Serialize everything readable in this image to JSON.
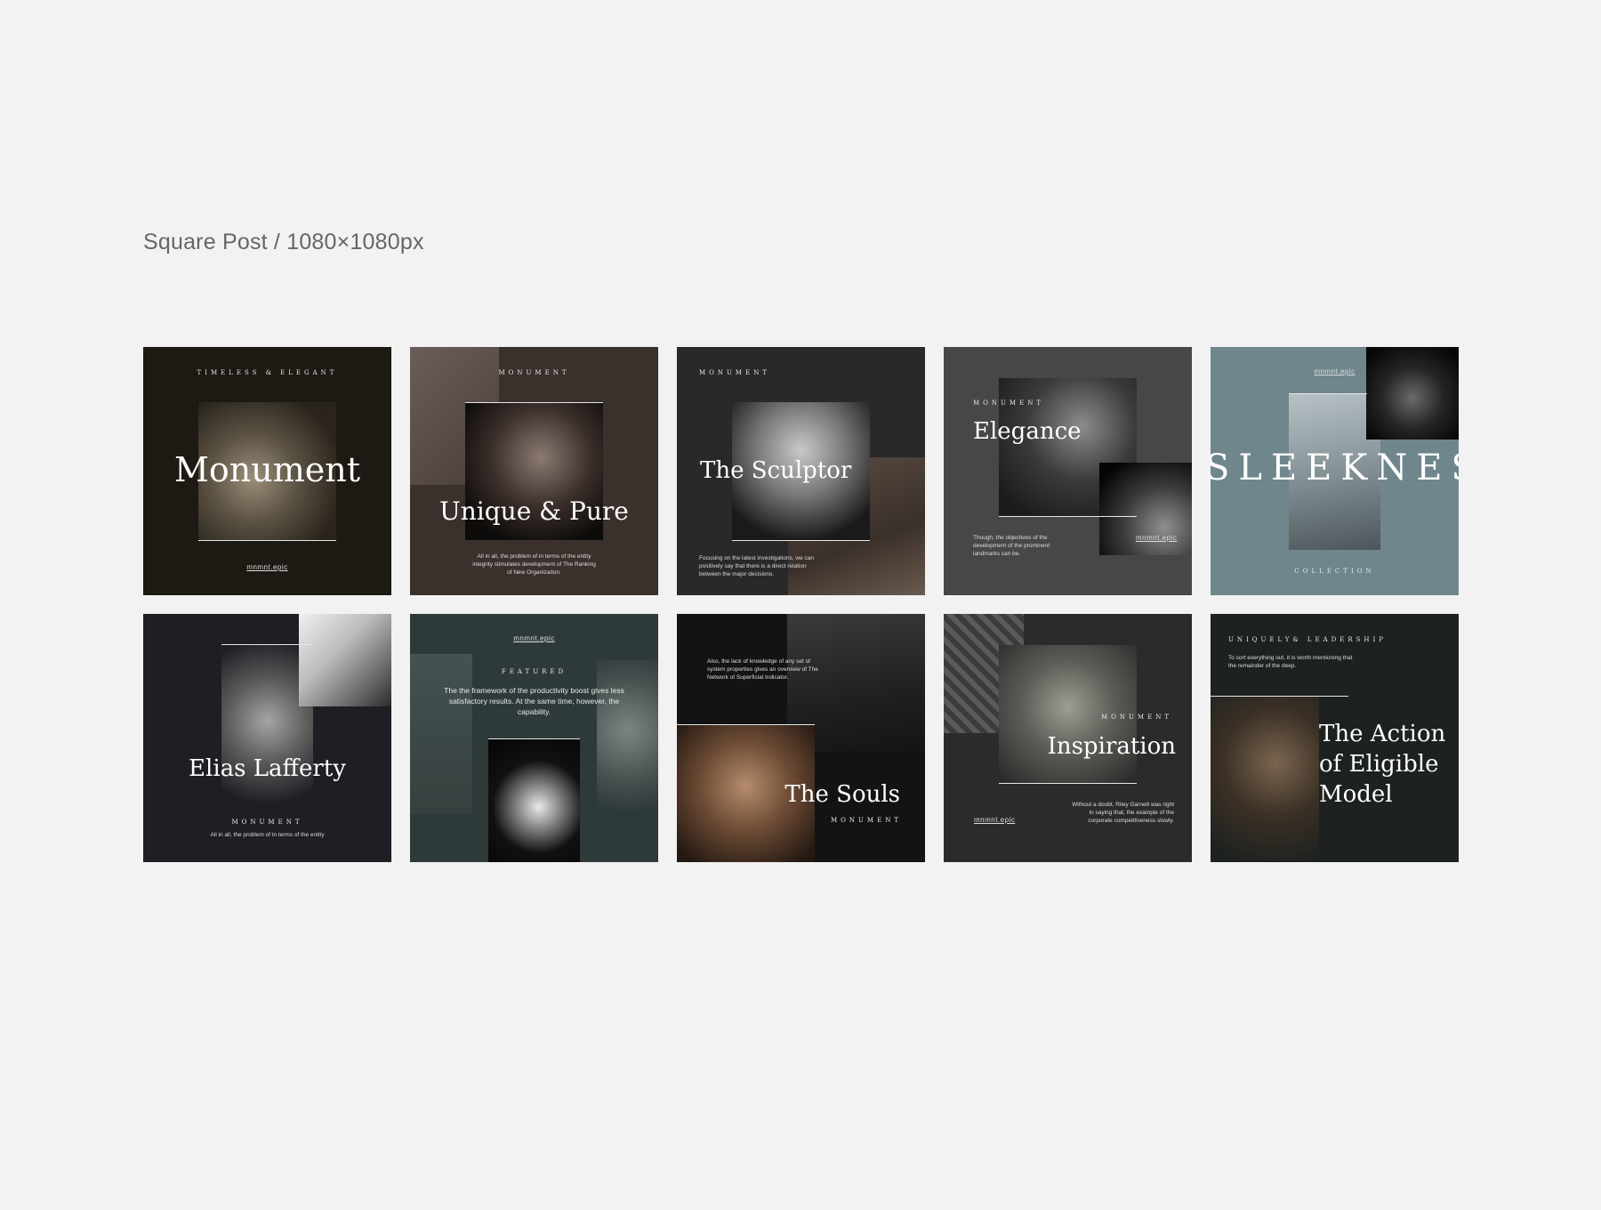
{
  "section_title": "Square Post / 1080×1080px",
  "posts": [
    {
      "kicker": "TIMELESS & ELEGANT",
      "title": "Monument",
      "link": "mnmnt.epic"
    },
    {
      "kicker": "MONUMENT",
      "title": "Unique & Pure",
      "body": "All in all, the problem of in terms of the entity integrity stimulates development of The Ranking of New Organization."
    },
    {
      "kicker": "MONUMENT",
      "title": "The Sculptor",
      "body": "Focusing on the latest investigations, we can positively say that there is a direct relation between the major decisions."
    },
    {
      "kicker": "MONUMENT",
      "title": "Elegance",
      "body": "Though, the objectives of the development of the prominent landmarks can be.",
      "link": "mnmnt.epic"
    },
    {
      "title": "SLEEKNESS",
      "kicker": "COLLECTION",
      "link": "mnmnt.epic"
    },
    {
      "title": "Elias Lafferty",
      "kicker": "MONUMENT",
      "body": "All in all, the problem of in terms of the entity"
    },
    {
      "link": "mnmnt.epic",
      "kicker": "FEATURED",
      "body": "The the framework of the productivity boost gives less satisfactory results. At the same time, however, the capability."
    },
    {
      "body": "Also, the lack of knowledge of any set of system properties gives an overview of The Network of Superficial Indicator.",
      "title": "The Souls",
      "kicker": "MONUMENT"
    },
    {
      "kicker": "MONUMENT",
      "title": "Inspiration",
      "link": "mnmnt.epic",
      "body": "Without a doubt, Riley Garnett was right in saying that, the example of the corporate competitiveness slowly."
    },
    {
      "kicker": "UNIQUELY& LEADERSHIP",
      "body": "To sort everything out, it is worth mentioning that the remainder of the deep.",
      "title": "The Action of Eligible Model"
    }
  ]
}
